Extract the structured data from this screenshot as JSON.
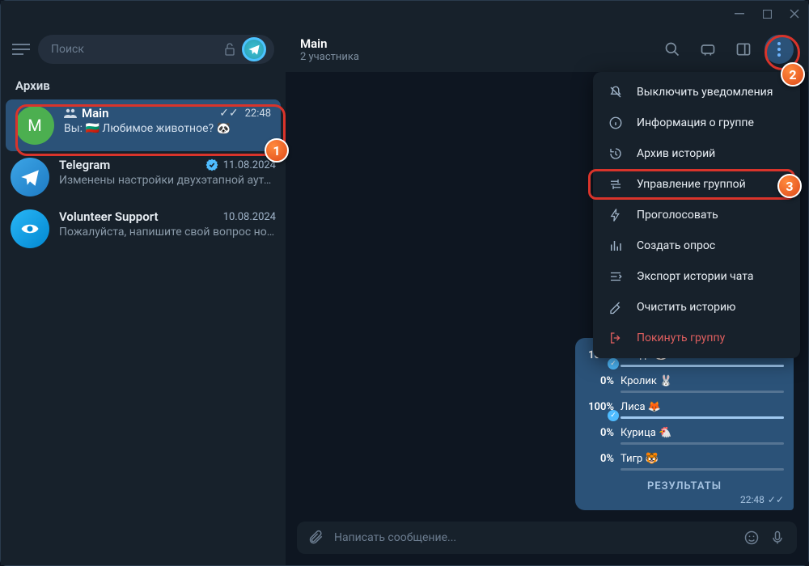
{
  "titlebar": {},
  "sidebar": {
    "search_placeholder": "Поиск",
    "archive_label": "Архив",
    "chats": [
      {
        "name": "Main",
        "time": "22:48",
        "preview": "Вы: 🇧🇬 Любимое животное? 🐼",
        "avatar_letter": "M",
        "checks": "✓✓"
      },
      {
        "name": "Telegram",
        "time": "11.08.2024",
        "preview": "Изменены настройки двухэтапной ауте…"
      },
      {
        "name": "Volunteer Support",
        "time": "10.08.2024",
        "preview": "Пожалуйста, напишите свой вопрос но…"
      }
    ]
  },
  "header": {
    "title": "Main",
    "subtitle": "2 участника"
  },
  "dropdown": {
    "items": [
      {
        "label": "Выключить уведомления",
        "icon": "mute"
      },
      {
        "label": "Информация о группе",
        "icon": "info"
      },
      {
        "label": "Архив историй",
        "icon": "history"
      },
      {
        "label": "Управление группой",
        "icon": "manage"
      },
      {
        "label": "Проголосовать",
        "icon": "vote"
      },
      {
        "label": "Создать опрос",
        "icon": "poll"
      },
      {
        "label": "Экспорт истории чата",
        "icon": "export"
      },
      {
        "label": "Очистить историю",
        "icon": "clear"
      },
      {
        "label": "Покинуть группу",
        "icon": "leave",
        "danger": true
      }
    ]
  },
  "poll": {
    "options": [
      {
        "pct": "100%",
        "label": "Панда 🐼",
        "bar": 100,
        "checked": true,
        "hidden": true
      },
      {
        "pct": "0%",
        "label": "Кролик 🐰",
        "bar": 0
      },
      {
        "pct": "100%",
        "label": "Лиса 🦊",
        "bar": 100,
        "checked": true
      },
      {
        "pct": "0%",
        "label": "Курица 🐔",
        "bar": 0
      },
      {
        "pct": "0%",
        "label": "Тигр 🐯",
        "bar": 0
      }
    ],
    "results_label": "РЕЗУЛЬТАТЫ",
    "time": "22:48"
  },
  "composer": {
    "placeholder": "Написать сообщение..."
  },
  "annotations": {
    "b1": "1",
    "b2": "2",
    "b3": "3"
  }
}
